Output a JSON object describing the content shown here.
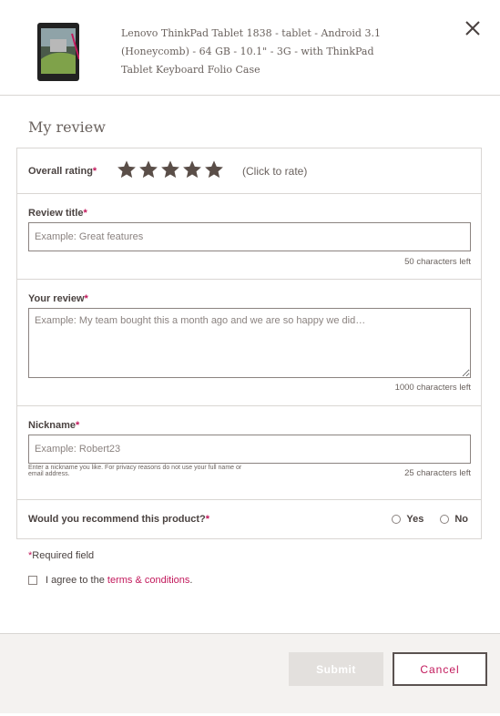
{
  "product": {
    "image_icon": "tablet-icon",
    "title": "Lenovo ThinkPad Tablet 1838 - tablet - Android 3.1 (Honeycomb) - 64 GB - 10.1\" - 3G - with ThinkPad Tablet Keyboard Folio Case"
  },
  "section_title": "My review",
  "rating": {
    "label": "Overall rating",
    "required_mark": "*",
    "stars": 5,
    "click_text": "(Click to rate)"
  },
  "review_title": {
    "label": "Review title",
    "required_mark": "*",
    "placeholder": "Example: Great features",
    "counter": "50 characters left"
  },
  "your_review": {
    "label": "Your review",
    "required_mark": "*",
    "placeholder": "Example: My team bought this a month ago and we are so happy we did…",
    "counter": "1000 characters left"
  },
  "nickname": {
    "label": "Nickname",
    "required_mark": "*",
    "placeholder": "Example: Robert23",
    "hint": "Enter a nickname you like. For privacy reasons do not use your full name or email address.",
    "counter": "25 characters left"
  },
  "recommend": {
    "label": "Would you recommend this product?",
    "required_mark": "*",
    "yes": "Yes",
    "no": "No"
  },
  "required_note": {
    "mark": "*",
    "text": "Required field"
  },
  "agree": {
    "prefix": "I agree to the ",
    "link": "terms & conditions",
    "suffix": "."
  },
  "buttons": {
    "submit": "Submit",
    "cancel": "Cancel"
  },
  "colors": {
    "accent": "#c2185b",
    "star": "#5a4e48",
    "border": "#d9d6d3"
  }
}
